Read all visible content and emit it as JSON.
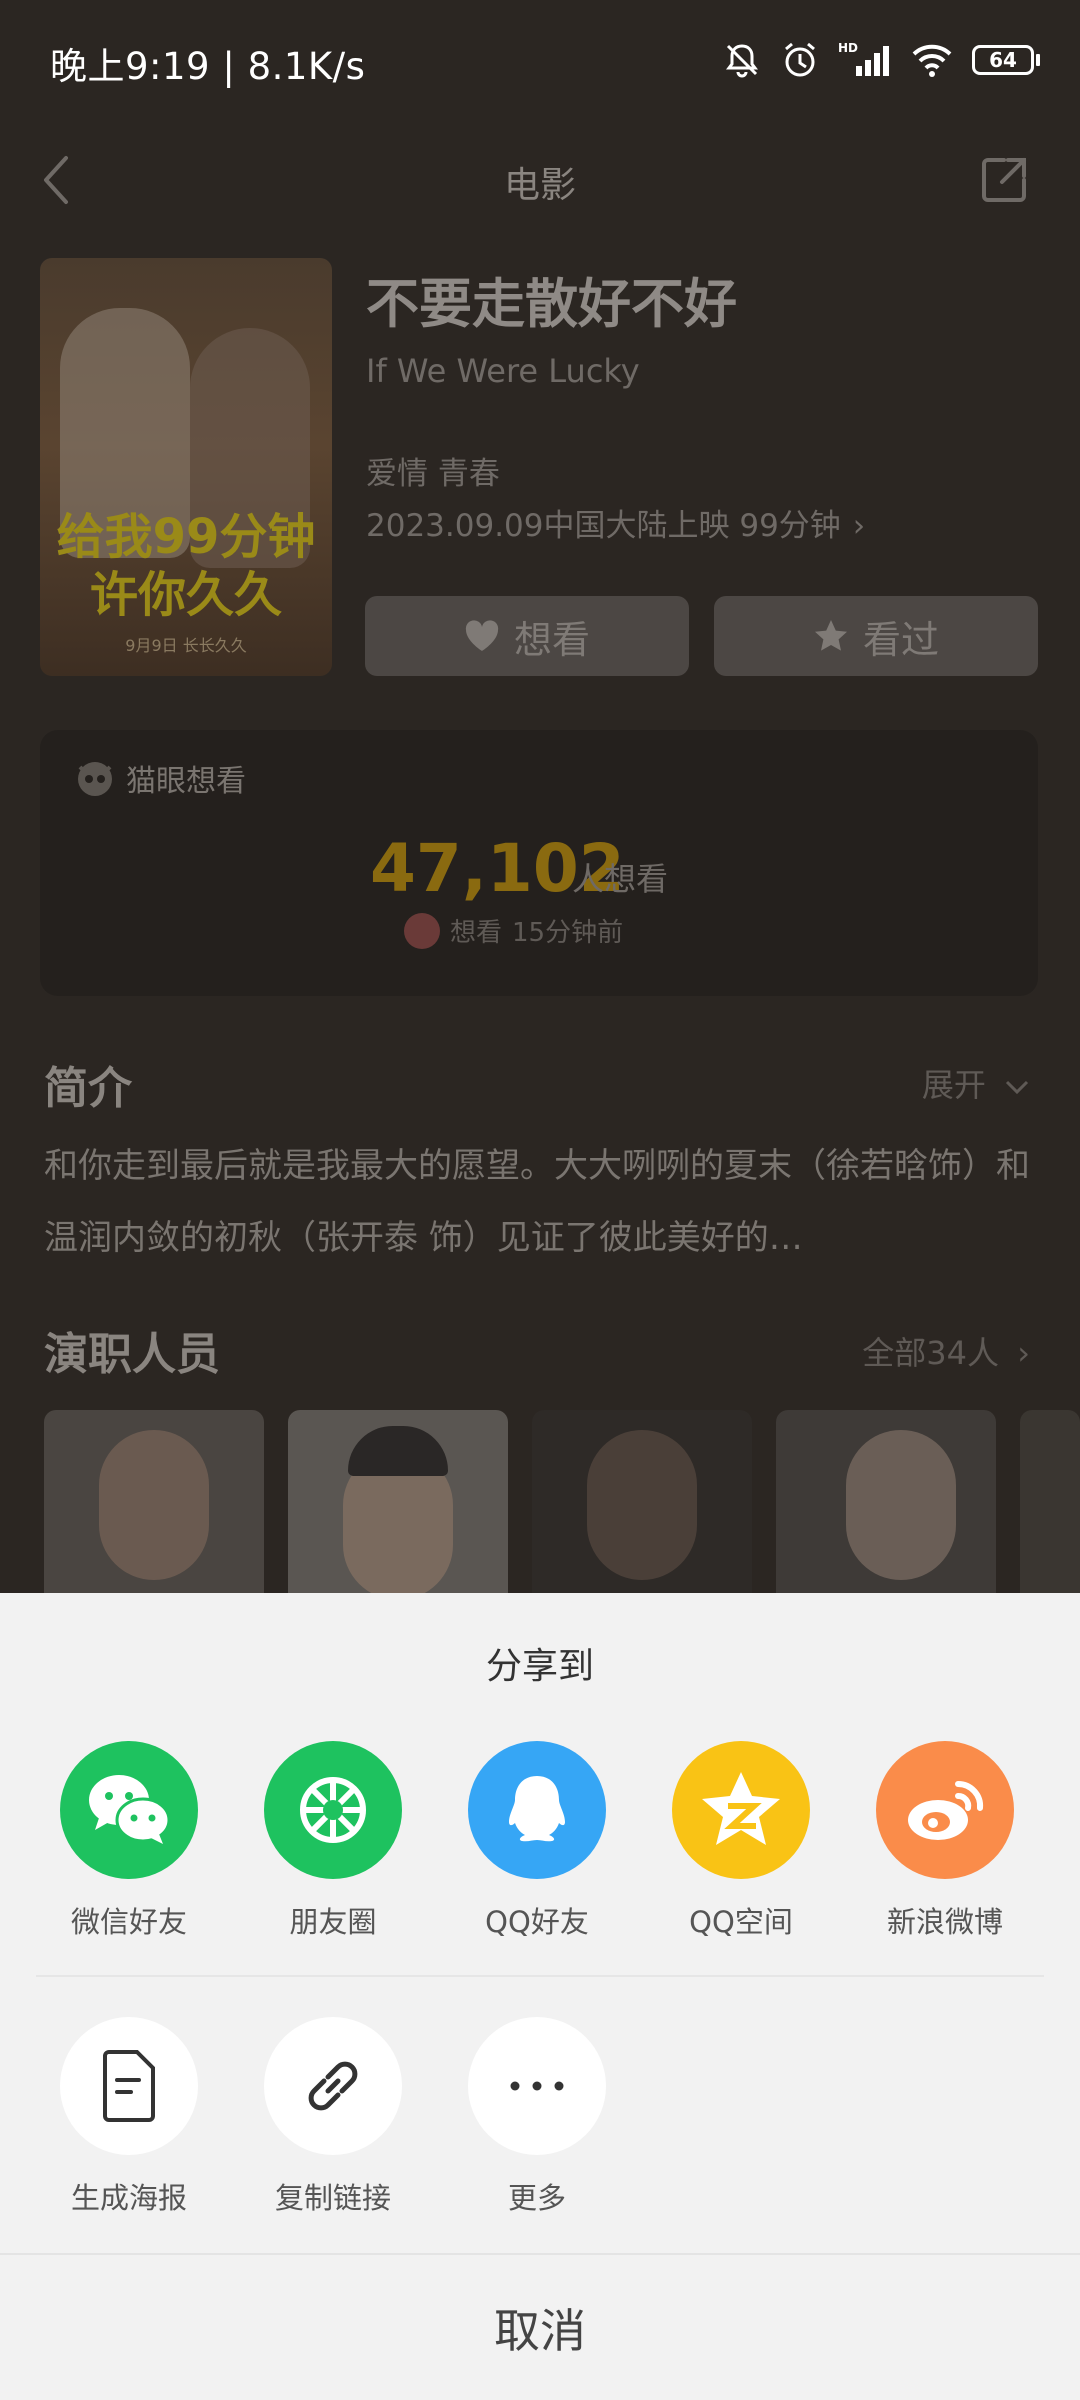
{
  "status_bar": {
    "time": "晚上9:19 | 8.1K/s",
    "icons": [
      "mute-bell-icon",
      "alarm-icon",
      "hd-signal-icon",
      "wifi-icon",
      "battery-icon"
    ],
    "battery_level": "64"
  },
  "nav": {
    "title": "电影",
    "icons": [
      "back-arrow-icon",
      "share-icon"
    ]
  },
  "movie": {
    "poster_text_line1": "给我99分钟",
    "poster_text_line2": "许你久久",
    "poster_date": "9月9日 长长久久",
    "title": "不要走散好不好",
    "english_title": "If We Were Lucky",
    "genres": "爱情 青春",
    "release_info": "2023.09.09中国大陆上映 99分钟",
    "want_button": "想看",
    "seen_button": "看过"
  },
  "maoyan_want": {
    "label": "猫眼想看",
    "count": "47,102",
    "unit": "人想看",
    "recent_action": "想看",
    "recent_time": "15分钟前"
  },
  "intro": {
    "title": "简介",
    "expand": "展开",
    "text": "和你走到最后就是我最大的愿望。大大咧咧的夏末（徐若晗饰）和温润内敛的初秋（张开泰 饰）见证了彼此美好的…"
  },
  "cast": {
    "title": "演职人员",
    "more": "全部34人"
  },
  "share_sheet": {
    "title": "分享到",
    "row1": [
      {
        "label": "微信好友",
        "icon": "wechat-icon",
        "color": "#1ec25f"
      },
      {
        "label": "朋友圈",
        "icon": "moments-icon",
        "color": "#1ec25f"
      },
      {
        "label": "QQ好友",
        "icon": "qq-icon",
        "color": "#36a6f5"
      },
      {
        "label": "QQ空间",
        "icon": "qzone-icon",
        "color": "#f9c315"
      },
      {
        "label": "新浪微博",
        "icon": "weibo-icon",
        "color": "#fa8c4a"
      }
    ],
    "row2": [
      {
        "label": "生成海报",
        "icon": "poster-doc-icon",
        "color": "#ffffff"
      },
      {
        "label": "复制链接",
        "icon": "link-icon",
        "color": "#ffffff"
      },
      {
        "label": "更多",
        "icon": "more-dots-icon",
        "color": "#ffffff"
      }
    ],
    "cancel": "取消"
  }
}
